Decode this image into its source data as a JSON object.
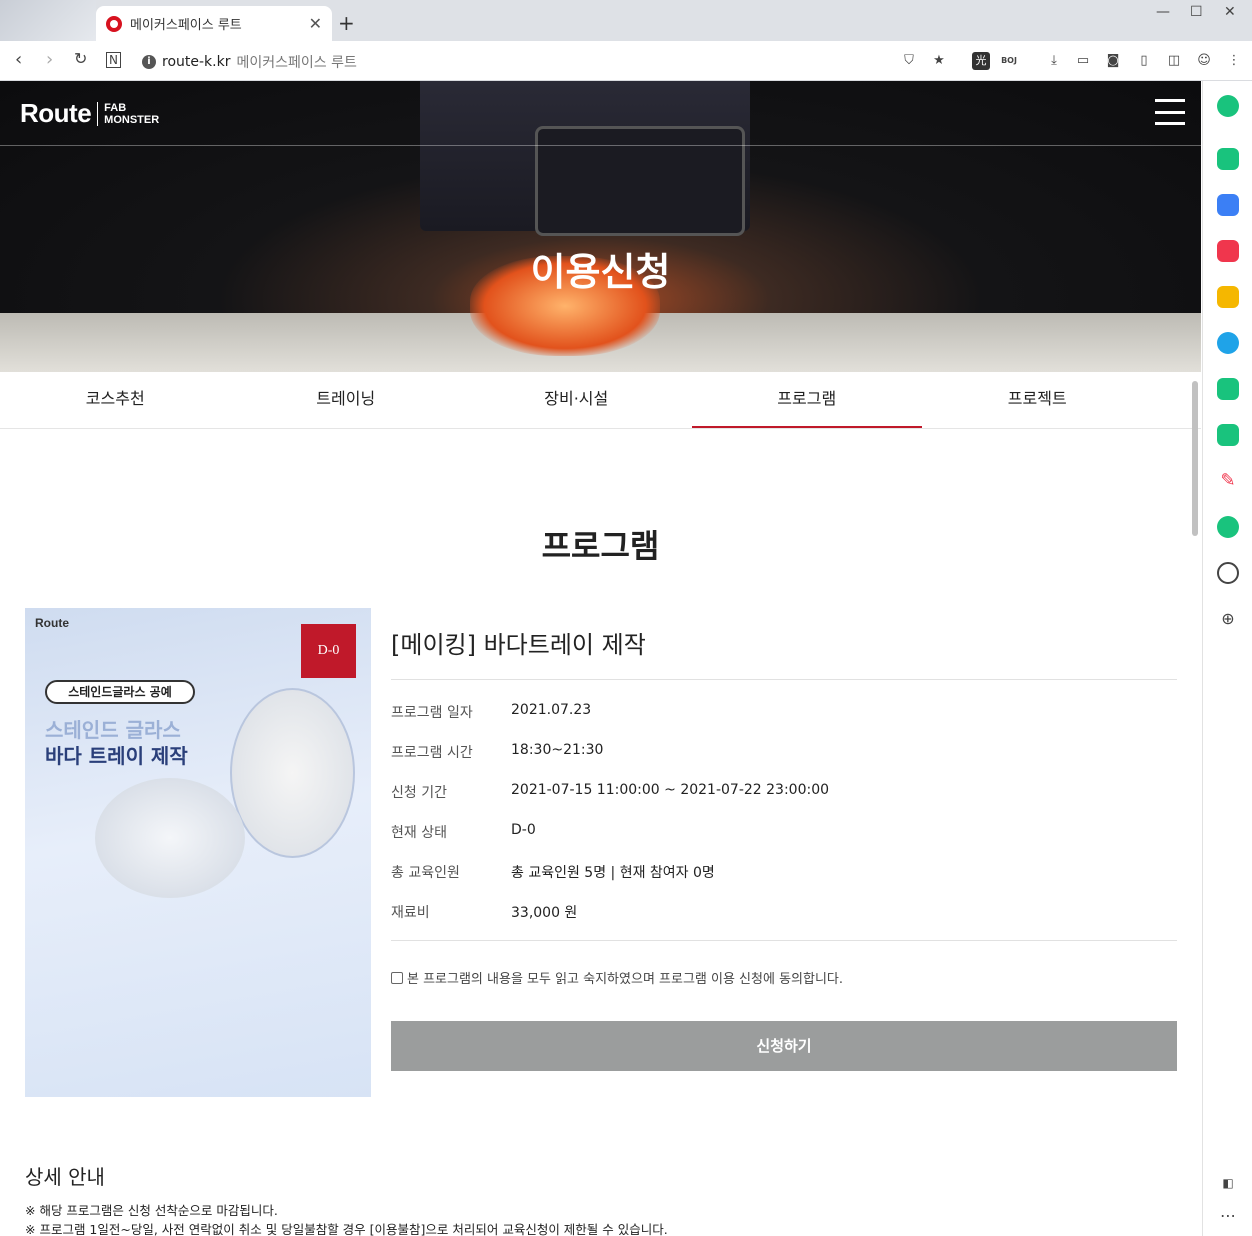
{
  "browser": {
    "tab_title": "메이커스페이스 루트",
    "url_host": "route-k.kr",
    "url_page_title": "메이커스페이스 루트",
    "ext_badges": [
      "光",
      "BOJ"
    ]
  },
  "site": {
    "logo_route": "Route",
    "logo_fab_line1": "FAB",
    "logo_fab_line2": "MONSTER",
    "hero_title": "이용신청"
  },
  "subnav": {
    "items": [
      "코스추천",
      "트레이닝",
      "장비·시설",
      "프로그램",
      "프로젝트"
    ],
    "active": "프로그램"
  },
  "section_title": "프로그램",
  "poster": {
    "logo": "Route",
    "pill": "스테인드글라스 공예",
    "line1": "스테인드 글라스",
    "line2": "바다 트레이 제작",
    "badge": "D-0"
  },
  "program": {
    "title": "[메이킹] 바다트레이 제작",
    "rows": [
      {
        "label": "프로그램 일자",
        "value": "2021.07.23"
      },
      {
        "label": "프로그램 시간",
        "value": "18:30~21:30"
      },
      {
        "label": "신청 기간",
        "value": "2021-07-15 11:00:00 ~ 2021-07-22 23:00:00"
      },
      {
        "label": "현재 상태",
        "value": "D-0"
      },
      {
        "label": "총 교육인원",
        "value": "총 교육인원 5명 | 현재 참여자 0명"
      },
      {
        "label": "재료비",
        "value": "33,000 원"
      }
    ],
    "agree_text": "본 프로그램의 내용을 모두 읽고 숙지하였으며 프로그램 이용 신청에 동의합니다.",
    "apply_label": "신청하기"
  },
  "detail": {
    "title": "상세 안내",
    "notes": [
      "※ 해당 프로그램은 신청 선착순으로 마감됩니다.",
      "※ 프로그램 1일전~당일, 사전 연락없이 취소 및 당일불참할 경우 [이용불참]으로 처리되어 교육신청이 제한될 수 있습니다."
    ]
  },
  "colors": {
    "accent_red": "#c0192a",
    "button_gray": "#9b9d9d"
  }
}
